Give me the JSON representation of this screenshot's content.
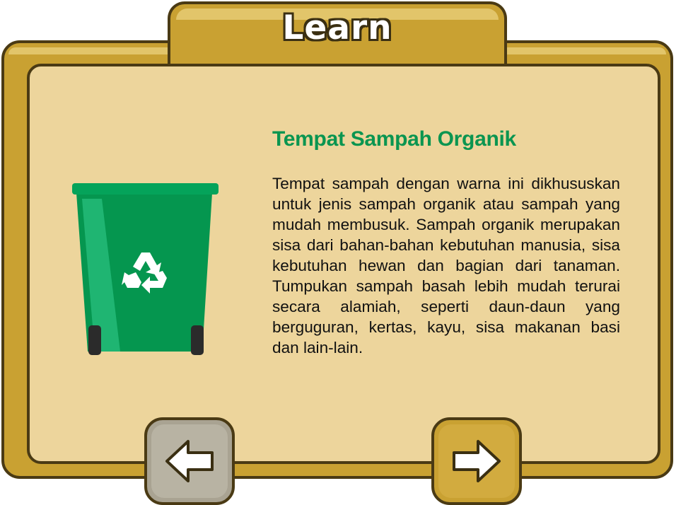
{
  "header": {
    "title": "Learn"
  },
  "card": {
    "heading": "Tempat Sampah Organik",
    "description": "Tempat sampah dengan warna ini dikhususkan untuk jenis sampah organik atau sampah yang mudah membusuk. Sampah organik merupakan sisa dari bahan-bahan kebutuhan manusia, sisa kebutuhan hewan dan bagian dari tanaman. Tumpukan sampah basah lebih mudah terurai secara alamiah, seperti daun-daun yang berguguran, kertas, kayu, sisa makanan basi dan lain-lain.",
    "image": {
      "icon": "green-recycle-bin-icon",
      "bin_color": "#05964f"
    }
  },
  "nav": {
    "prev_icon": "arrow-left-icon",
    "next_icon": "arrow-right-icon"
  },
  "colors": {
    "frame": "#c9a132",
    "panel": "#edd59c",
    "heading": "#0a9550",
    "outline": "#4a3a14"
  }
}
